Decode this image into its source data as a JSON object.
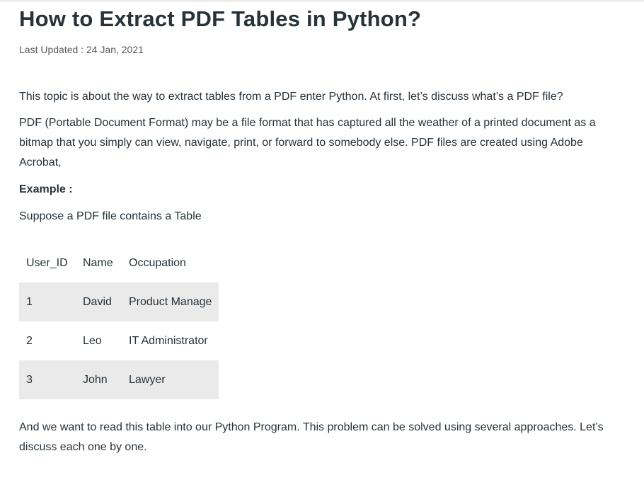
{
  "article": {
    "title": "How to Extract PDF Tables in Python?",
    "last_updated": "Last Updated : 24 Jan, 2021",
    "intro": "This topic is about the way to extract tables from a PDF enter Python. At first, let’s discuss what’s a PDF file?",
    "pdf_description": "PDF (Portable Document Format) may be a file format that has captured all the weather of a printed document as a bitmap that you simply can view, navigate, print, or forward to somebody else. PDF files are created using Adobe Acrobat,",
    "example_label": "Example :",
    "table_intro": "Suppose a PDF file contains a Table",
    "outro": "And we want to read this table into our Python Program. This problem can be solved using several approaches. Let’s discuss each one by one."
  },
  "table": {
    "headers": [
      "User_ID",
      "Name",
      "Occupation"
    ],
    "rows": [
      [
        "1",
        "David",
        "Product Manage"
      ],
      [
        "2",
        "Leo",
        "IT Administrator"
      ],
      [
        "3",
        "John",
        "Lawyer"
      ]
    ]
  },
  "colors": {
    "text": "#273239",
    "row_shade": "#eaeaea"
  }
}
